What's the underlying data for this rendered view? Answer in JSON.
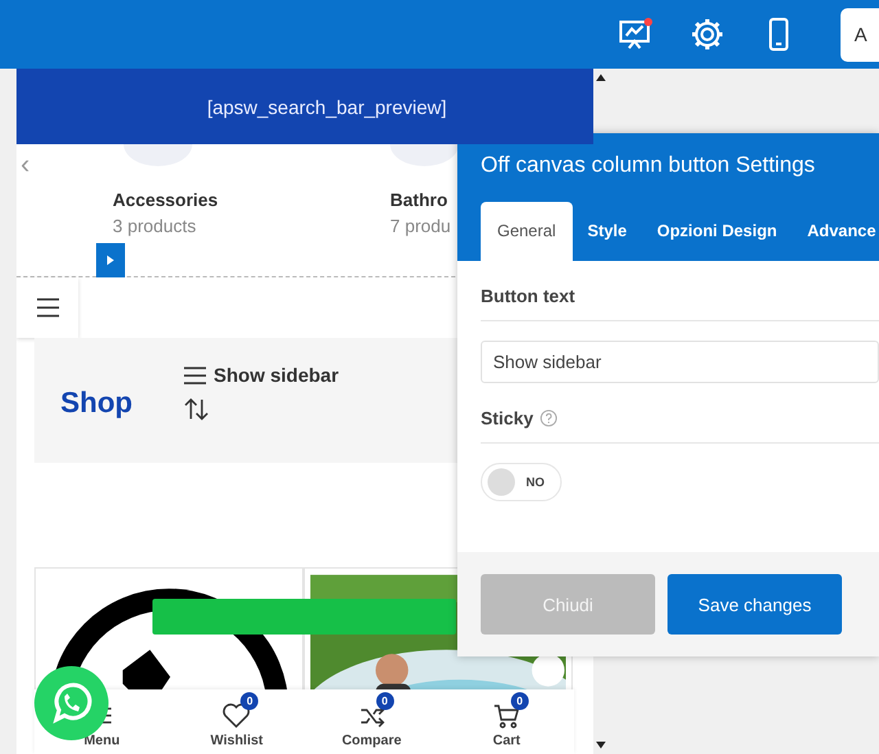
{
  "toolbar": {
    "button_label": "A"
  },
  "preview": {
    "banner": "[apsw_search_bar_preview]",
    "previous_arrow": "‹",
    "categories": [
      {
        "name": "Accessories",
        "count": "3 products"
      },
      {
        "name": "Bathro",
        "count": "7 produ"
      }
    ],
    "shop_bar": {
      "title": "Shop",
      "sidebar_button": "Show sidebar"
    },
    "bottom_nav": [
      {
        "label": "Menu"
      },
      {
        "label": "Wishlist",
        "badge": "0"
      },
      {
        "label": "Compare",
        "badge": "0"
      },
      {
        "label": "Cart",
        "badge": "0"
      }
    ]
  },
  "dialog": {
    "title": "Off canvas column button Settings",
    "tabs": [
      {
        "label": "General",
        "selected": true
      },
      {
        "label": "Style",
        "selected": false
      },
      {
        "label": "Opzioni Design",
        "selected": false
      },
      {
        "label": "Advance",
        "selected": false
      }
    ],
    "fields": [
      {
        "kind": "text",
        "label": "Button text",
        "value": "Show sidebar"
      },
      {
        "kind": "toggle",
        "label": "Sticky",
        "on": false,
        "state_label": "NO"
      }
    ],
    "buttons": [
      {
        "label": "Chiudi",
        "kind": "secondary"
      },
      {
        "label": "Save changes",
        "kind": "primary"
      }
    ]
  }
}
